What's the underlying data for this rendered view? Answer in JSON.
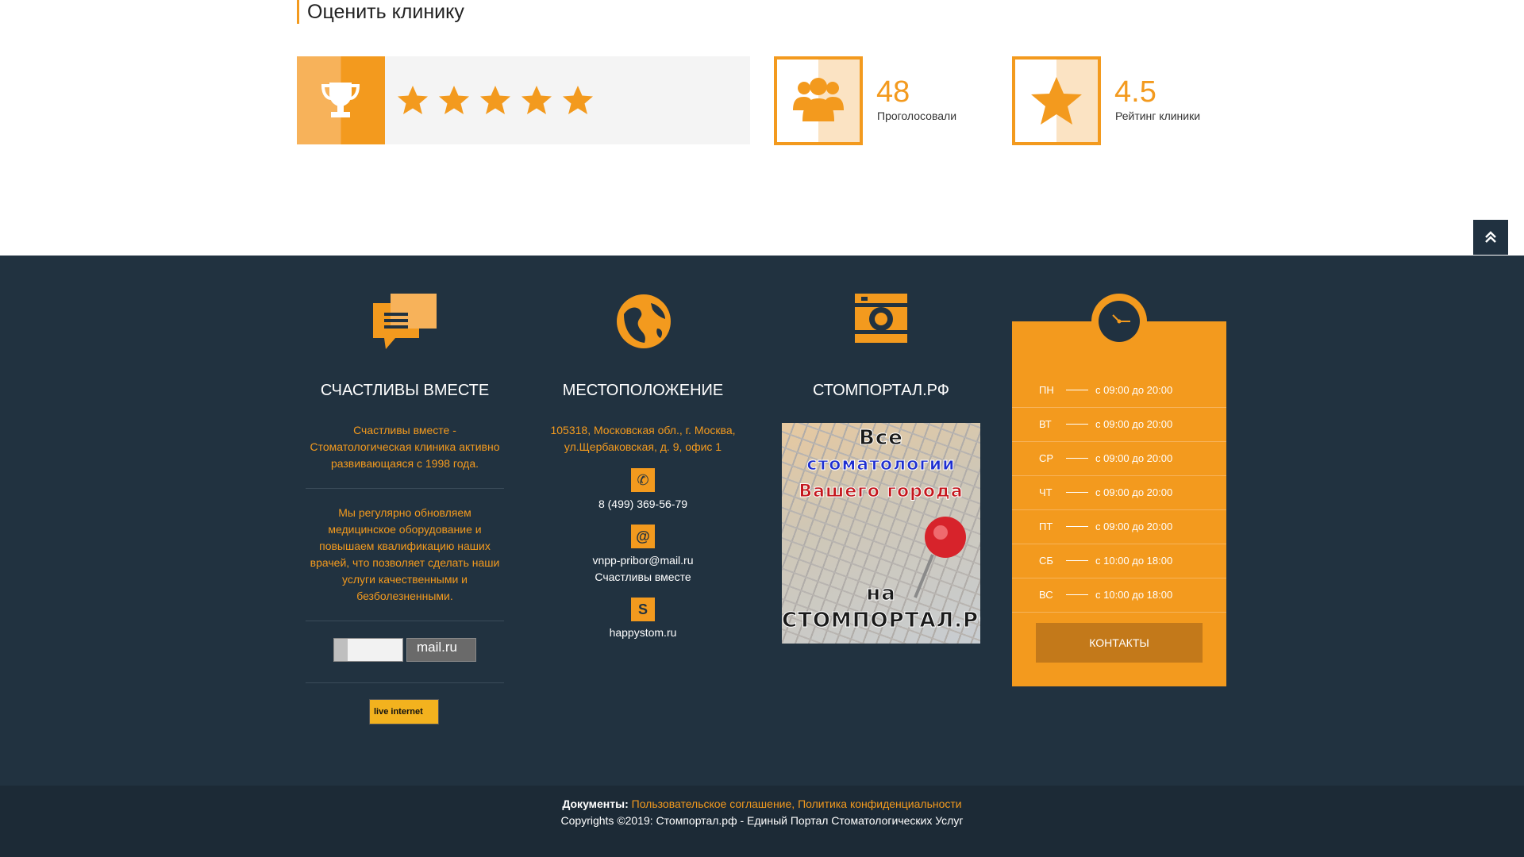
{
  "rating": {
    "title": "Оценить клинику",
    "stars_selected": 5,
    "stars_total": 5,
    "votes_count": "48",
    "votes_label": "Проголосовали",
    "rating_value": "4.5",
    "rating_label": "Рейтинг клиники"
  },
  "colors": {
    "accent": "#f39a1e",
    "footer_bg": "#213240",
    "bottom_bg": "#1c2a36",
    "button_dark": "#c3791a"
  },
  "footer": {
    "col1": {
      "icon": "chat-bubbles-icon",
      "title": "СЧАСТЛИВЫ ВМЕСТЕ",
      "text1": "Счастливы вместе - Стоматологическая клиника активно развивающаяся с 1998 года.",
      "text2": "Мы регулярно обновляем медицинское оборудование и повышаем квалификацию наших врачей, что позволяет сделать наши услуги качественными и безболезненными.",
      "counter_mail": "mail.ru",
      "counter_li": "live internet"
    },
    "col2": {
      "icon": "globe-icon",
      "title": "МЕСТОПОЛОЖЕНИЕ",
      "address": "105318, Московская обл., г. Москва, ул.Щербаковская, д. 9, офис 1",
      "phone": "8 (499) 369-56-79",
      "email": "vnpp-pribor@mail.ru",
      "email_note": "Счастливы вместе",
      "site": "happystom.ru"
    },
    "col3": {
      "icon": "camera-icon",
      "title": "СТОМПОРТАЛ.РФ",
      "banner_lines": [
        "Все",
        "стоматологии",
        "Вашего города",
        "на",
        "СТОМПОРТАЛ.РФ"
      ]
    },
    "schedule": {
      "icon": "clock-icon",
      "rows": [
        {
          "day": "ПН",
          "time": "с 09:00 до 20:00"
        },
        {
          "day": "ВТ",
          "time": "с 09:00 до 20:00"
        },
        {
          "day": "СР",
          "time": "с 09:00 до 20:00"
        },
        {
          "day": "ЧТ",
          "time": "с 09:00 до 20:00"
        },
        {
          "day": "ПТ",
          "time": "с 09:00 до 20:00"
        },
        {
          "day": "СБ",
          "time": "с 10:00 до 18:00"
        },
        {
          "day": "ВС",
          "time": "с 10:00 до 18:00"
        }
      ],
      "button": "КОНТАКТЫ"
    }
  },
  "bottom": {
    "docs_label": "Документы:",
    "link1": "Пользовательское соглашение",
    "separator": ",",
    "link2": "Политика конфиденциальности",
    "copyright": "Copyrights ©2019: Стомпортал.рф - Единый Портал Стоматологических Услуг"
  }
}
